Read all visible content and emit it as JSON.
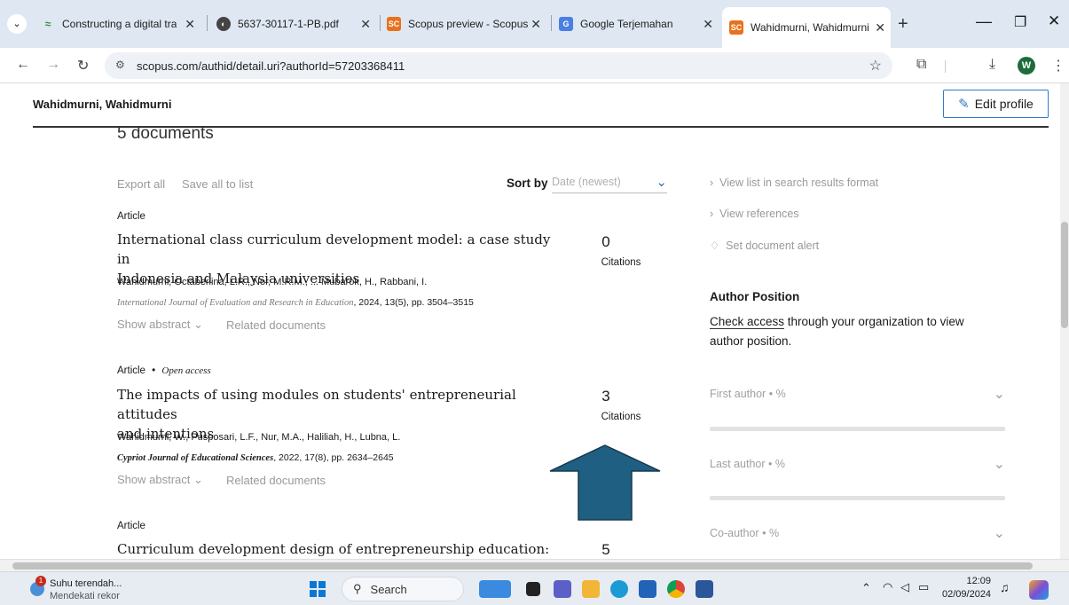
{
  "browser": {
    "tabs": [
      {
        "title": "Constructing a digital tra",
        "favicon": "leaf-icon"
      },
      {
        "title": "5637-30117-1-PB.pdf",
        "favicon": "globe-icon"
      },
      {
        "title": "Scopus preview - Scopus",
        "favicon": "SC"
      },
      {
        "title": "Google Terjemahan",
        "favicon": "translate-icon"
      },
      {
        "title": "Wahidmurni, Wahidmurni",
        "favicon": "SC",
        "active": true
      }
    ],
    "new_tab": "+",
    "url": "scopus.com/authid/detail.uri?authorId=57203368411",
    "profile_initial": "W"
  },
  "header": {
    "author_name": "Wahidmurni, Wahidmurni",
    "edit_profile": "Edit profile"
  },
  "documents": {
    "count_label": "5 documents",
    "export_all": "Export all",
    "save_all": "Save all to list",
    "sort_by": "Sort by",
    "sort_value": "Date (newest)",
    "items": [
      {
        "type": "Article",
        "open_access": "",
        "title_line1": "International class curriculum development model: a case study in",
        "title_line2": "Indonesia and Malaysia universities",
        "authors": "Wahidmurni, Octaberlina, L.R., Nor, M.R.M., ... Mubarok, H., Rabbani, I.",
        "journal": "International Journal of Evaluation and Research in Education",
        "journal_rest": ", 2024, 13(5), pp. 3504–3515",
        "citations": "0",
        "citations_label": "Citations",
        "show_abstract": "Show abstract",
        "related": "Related documents"
      },
      {
        "type": "Article",
        "open_access": "Open access",
        "title_line1": "The impacts of using modules on students' entrepreneurial attitudes",
        "title_line2": "and intentions",
        "authors": "Wahidmurni, W., Pusposari, L.F., Nur, M.A., Haliliah, H., Lubna, L.",
        "journal": "Cypriot Journal of Educational Sciences",
        "journal_rest": ", 2022, 17(8), pp. 2634–2645",
        "citations": "3",
        "citations_label": "Citations",
        "show_abstract": "Show abstract",
        "related": "Related documents"
      },
      {
        "type": "Article",
        "title_line1": "Curriculum development design of entrepreneurship education: A",
        "citations": "5"
      }
    ]
  },
  "sidebar": {
    "view_list": "View list in search results format",
    "view_references": "View references",
    "set_alert": "Set document alert",
    "author_position_heading": "Author Position",
    "check_access": "Check access",
    "access_rest": " through your organization to view",
    "access_line2": "author position.",
    "positions": [
      {
        "label": "First author",
        "value": "%"
      },
      {
        "label": "Last author",
        "value": "%"
      },
      {
        "label": "Co-author",
        "value": "%"
      }
    ],
    "bullet": "•"
  },
  "taskbar": {
    "weather_title": "Suhu terendah...",
    "weather_sub": "Mendekati rekor",
    "notification_count": "1",
    "search": "Search",
    "time": "12:09",
    "date": "02/09/2024"
  },
  "colors": {
    "arrow": "#1f5f82",
    "scopus_orange": "#e9711c",
    "edit_border": "#2f7ac6"
  }
}
